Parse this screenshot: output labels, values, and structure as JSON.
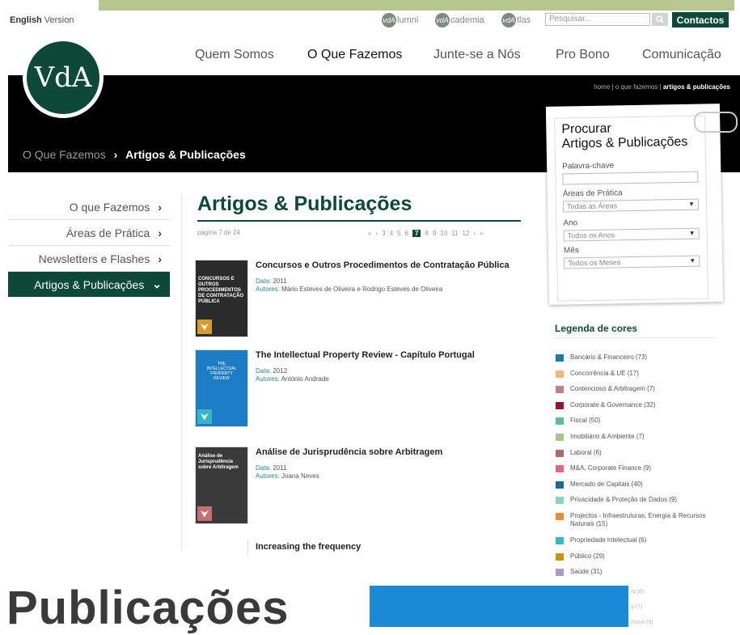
{
  "header": {
    "lang_bold": "English",
    "lang_rest": " Version",
    "sites": [
      {
        "badge": "vdA",
        "label": "lumni"
      },
      {
        "badge": "vdA",
        "label": "cademia"
      },
      {
        "badge": "vdA",
        "label": "tlas"
      }
    ],
    "search_placeholder": "Pesquisar...",
    "contact_label": "Contactos",
    "logo_text": "VdA",
    "nav": [
      "Quem Somos",
      "O Que Fazemos",
      "Junte-se a Nós",
      "Pro Bono",
      "Comunicação"
    ]
  },
  "banner": {
    "breadcrumb": {
      "home": "home",
      "sep": "|",
      "level1": "o que fazemos",
      "current": "artigos & publicações"
    },
    "title_muted": "O Que Fazemos",
    "title_arrow": "›",
    "title_main": "Artigos & Publicações"
  },
  "sidebar": {
    "items": [
      "O que Fazemos",
      "Áreas de Prática",
      "Newsletters e Flashes",
      "Artigos & Publicações"
    ],
    "chev_right": "›",
    "chev_down": "⌄"
  },
  "main": {
    "title": "Artigos & Publicações",
    "page_label": "página 7 de 24",
    "pager": {
      "first": "«",
      "prev": "‹",
      "pages": [
        "3",
        "4",
        "5",
        "6"
      ],
      "current": "7",
      "after": [
        "8",
        "9",
        "10",
        "11",
        "12"
      ],
      "next": "›",
      "last": "»"
    },
    "date_label": "Data:",
    "authors_label": "Autores:",
    "publications": [
      {
        "title": "Concursos e Outros Procedimentos de Contratação Pública",
        "cover": "CONCURSOS E OUTROS PROCEDIMENTOS DE CONTRATAÇÃO PÚBLICA",
        "date": "2011",
        "authors": "Mário Esteves de Oliveira e Rodrigo Esteves de Oliveira"
      },
      {
        "title": "The Intellectual Property Review - Capítulo Portugal",
        "cover": "THE INTELLECTUAL PROPERTY REVIEW",
        "date": "2012",
        "authors": "António Andrade"
      },
      {
        "title": "Análise de Jurisprudência sobre Arbitragem",
        "cover": "Análise de Jurisprudência sobre Arbitragem",
        "date": "2011",
        "authors": "Joana Neves"
      },
      {
        "title": "Increasing the frequency"
      }
    ]
  },
  "search_panel": {
    "title_line1": "Procurar",
    "title_line2": "Artigos & Publicações",
    "keyword_label": "Palavra-chave",
    "areas_label": "Áreas de Prática",
    "areas_value": "Todas as Áreas",
    "year_label": "Ano",
    "year_value": "Todos os Anos",
    "month_label": "Mês",
    "month_value": "Todos os Meses"
  },
  "legend": {
    "title": "Legenda de cores",
    "items": [
      {
        "label": "Bancário & Financeiro (73)",
        "color": "#1a7aa8"
      },
      {
        "label": "Concorrência & UE (17)",
        "color": "#f2b774"
      },
      {
        "label": "Contencioso & Arbitragem (7)",
        "color": "#c48080"
      },
      {
        "label": "Corporate & Governance (32)",
        "color": "#9b1230"
      },
      {
        "label": "Fiscal (50)",
        "color": "#5cbf9c"
      },
      {
        "label": "Imobiliário & Ambiente (7)",
        "color": "#a3c98a"
      },
      {
        "label": "Laboral (6)",
        "color": "#b06a6a"
      },
      {
        "label": "M&A, Corporate Finance (9)",
        "color": "#e5667d"
      },
      {
        "label": "Mercado de Capitais (40)",
        "color": "#176b96"
      },
      {
        "label": "Privacidade & Proteção de Dados (9)",
        "color": "#8fd0c4"
      },
      {
        "label": "Projectos - Infraestruturas, Energia & Recursos Naturais (15)",
        "color": "#f08a3a"
      },
      {
        "label": "Propriedade Intelectual (6)",
        "color": "#39b7c9"
      },
      {
        "label": "Público (29)",
        "color": "#c9950f"
      },
      {
        "label": "Saúde (31)",
        "color": "#a89cc8"
      }
    ],
    "faded": [
      "ia (8)",
      "g (7)",
      "rismo (9)"
    ]
  },
  "overlay": {
    "zoom_text": "Publicações"
  },
  "colors": {
    "brand_green": "#0c4a37",
    "accent_band": "#b7c78e",
    "overlay_blue": "#1a8ad6"
  }
}
